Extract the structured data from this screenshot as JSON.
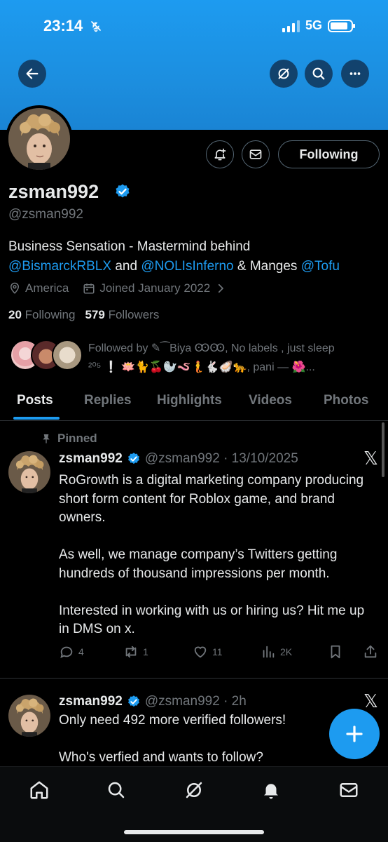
{
  "status_bar": {
    "time": "23:14",
    "network": "5G",
    "battery_level": 0.85
  },
  "nav": {
    "back_icon": "arrow-left-icon",
    "grok_icon": "grok-icon",
    "search_icon": "search-icon",
    "more_icon": "more-horizontal-icon"
  },
  "profile": {
    "name": "zsman992",
    "handle": "@zsman992",
    "bio_prefix": "Business Sensation - Mastermind behind",
    "mention_1": "@BismarckRBLX",
    "bio_and": "and",
    "mention_2": "@NOLIsInferno",
    "bio_amp": "& Manges",
    "mention_3": "@Tofu",
    "location": "America",
    "joined": "Joined January 2022",
    "following_count": "20",
    "following_label": "Following",
    "followers_count": "579",
    "followers_label": "Followers",
    "followed_by_line1": "Followed by ✎⁀Biya ꙬꙬ, No labels , just sleep",
    "followed_by_line2": "²⁰⁵ ❕ 🪷🐈🍒🦭🪱🧜🐇🦪🐆, pani — 🌺..."
  },
  "buttons": {
    "following": "Following",
    "notify_icon": "bell-plus-icon",
    "message_icon": "envelope-icon"
  },
  "tabs": [
    "Posts",
    "Replies",
    "Highlights",
    "Videos",
    "Photos"
  ],
  "pinned_label": "Pinned",
  "posts": [
    {
      "name": "zsman992",
      "meta": "@zsman992 · 13/10/2025",
      "text_p1": "RoGrowth is a digital marketing company producing short form content for Roblox game, and brand owners.",
      "text_p2": "As well, we manage company’s Twitters getting hundreds of thousand impressions per month.",
      "text_p3": "Interested in working with us or hiring us? Hit me up in DMS on x.",
      "replies": "4",
      "reposts": "1",
      "likes": "11",
      "views": "2K"
    },
    {
      "name": "zsman992",
      "meta": "@zsman992 · 2h",
      "text_p1": "Only need 492 more verified followers!",
      "text_p2": "Who's verfied and wants to follow?"
    }
  ],
  "x_logo": "𝕏",
  "colors": {
    "accent": "#1d9bf0",
    "banner": "#1d9bf0",
    "background": "#000000",
    "muted": "#71767b"
  },
  "bottom_nav": [
    "home-icon",
    "search-icon",
    "grok-icon",
    "notifications-icon",
    "messages-icon"
  ]
}
